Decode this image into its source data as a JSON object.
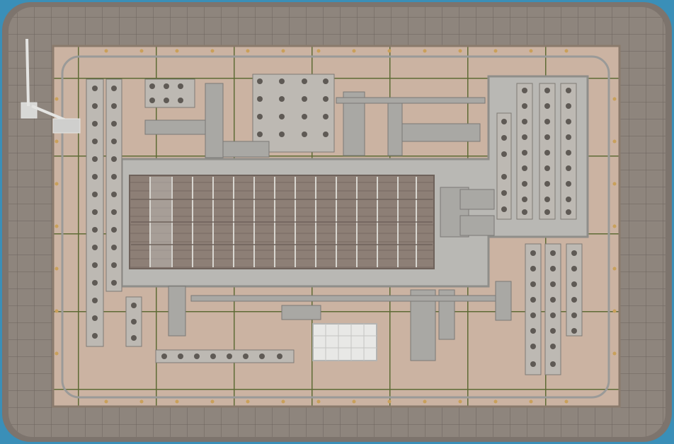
{
  "scene": {
    "subject": "rooftop-mechanical-equipment-aerial",
    "colors": {
      "frame_border": "#3a8fb8",
      "parapet_outer": "#7d746d",
      "parapet_inner": "#8e857d",
      "parapet_tile_line": "#6c645d",
      "roof_floor": "#cbb3a2",
      "roof_grid_line": "#5e6b35",
      "dot_marker": "#c9a05a",
      "pipe": "#9a9a98",
      "platform": "#b9b8b4",
      "platform_edge": "#8f8e8a",
      "solar_panel": "#8d7f76",
      "solar_line": "#d8d6d0",
      "ac_unit": "#bdb9b3",
      "ac_fan": "#5f5a55",
      "duct": "#a9a8a4",
      "water_tank": "#e8e8e6"
    }
  }
}
